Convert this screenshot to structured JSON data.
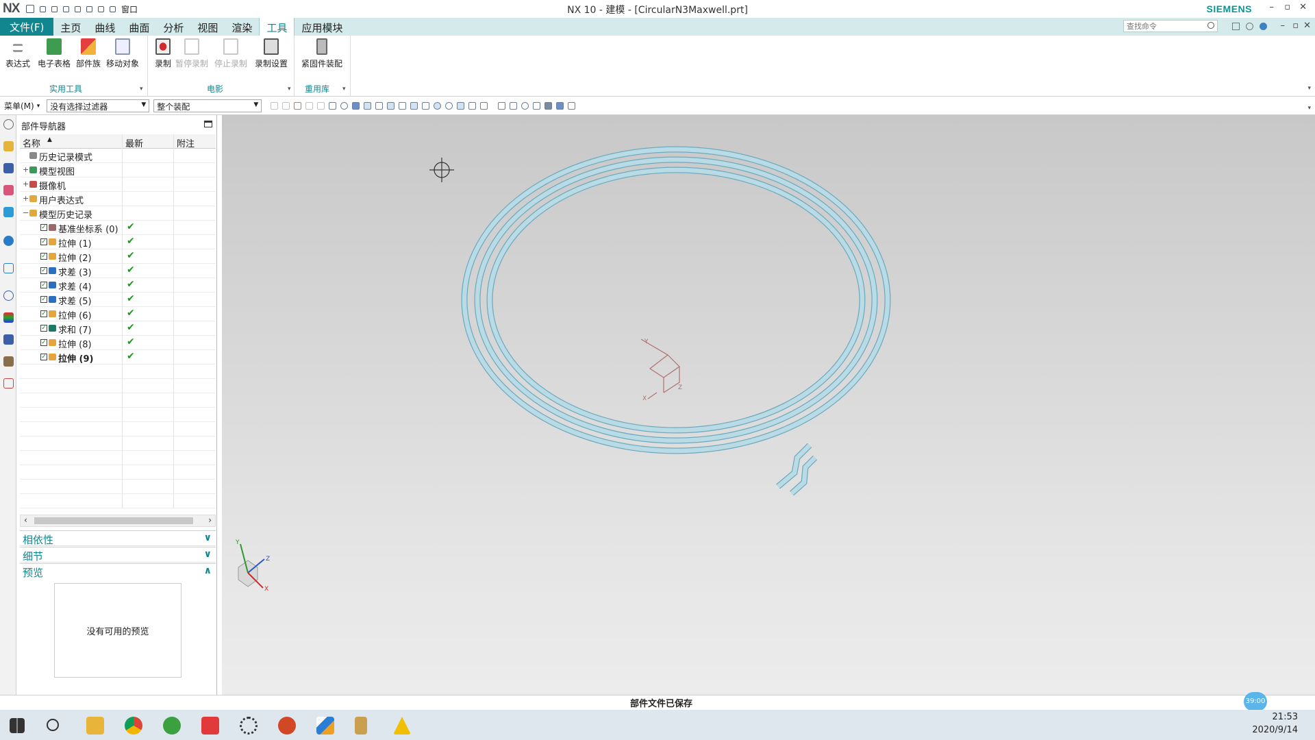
{
  "window": {
    "app_logo": "NX",
    "title": "NX 10 - 建模 - [CircularN3Maxwell.prt]",
    "brand": "SIEMENS",
    "quick_access_window": "窗口"
  },
  "menu": {
    "file": "文件(F)",
    "tabs": [
      "主页",
      "曲线",
      "曲面",
      "分析",
      "视图",
      "渲染",
      "工具",
      "应用模块"
    ],
    "active_tab": "工具",
    "search_placeholder": "查找命令"
  },
  "ribbon": {
    "groups": [
      {
        "label": "实用工具",
        "buttons": [
          "表达式",
          "电子表格",
          "部件族",
          "移动对象"
        ]
      },
      {
        "label": "电影",
        "buttons": [
          "录制",
          "暂停录制",
          "停止录制",
          "录制设置"
        ]
      },
      {
        "label": "重用库",
        "buttons": [
          "紧固件装配"
        ]
      }
    ]
  },
  "selection_bar": {
    "menu_button": "菜单(M)",
    "filter": "没有选择过滤器",
    "scope": "整个装配"
  },
  "navigator": {
    "title": "部件导航器",
    "columns": [
      "名称",
      "最新",
      "附注"
    ],
    "top_items": [
      {
        "label": "历史记录模式",
        "icon": "history-mode-icon",
        "expander": ""
      },
      {
        "label": "模型视图",
        "icon": "model-views-icon",
        "expander": "+"
      },
      {
        "label": "摄像机",
        "icon": "camera-icon",
        "expander": "+"
      },
      {
        "label": "用户表达式",
        "icon": "folder-icon",
        "expander": "+"
      },
      {
        "label": "模型历史记录",
        "icon": "folder-open-icon",
        "expander": "−"
      }
    ],
    "history": [
      {
        "label": "基准坐标系 (0)",
        "icon": "datum-csys-icon",
        "up_to_date": true
      },
      {
        "label": "拉伸 (1)",
        "icon": "extrude-icon",
        "up_to_date": true
      },
      {
        "label": "拉伸 (2)",
        "icon": "extrude-icon",
        "up_to_date": true
      },
      {
        "label": "求差 (3)",
        "icon": "subtract-icon",
        "up_to_date": true
      },
      {
        "label": "求差 (4)",
        "icon": "subtract-icon",
        "up_to_date": true
      },
      {
        "label": "求差 (5)",
        "icon": "subtract-icon",
        "up_to_date": true
      },
      {
        "label": "拉伸 (6)",
        "icon": "extrude-icon",
        "up_to_date": true
      },
      {
        "label": "求和 (7)",
        "icon": "unite-icon",
        "up_to_date": true
      },
      {
        "label": "拉伸 (8)",
        "icon": "extrude-icon",
        "up_to_date": true
      },
      {
        "label": "拉伸 (9)",
        "icon": "extrude-icon",
        "up_to_date": true,
        "bold": true
      }
    ],
    "panels": [
      {
        "label": "相依性",
        "state": "collapsed"
      },
      {
        "label": "细节",
        "state": "collapsed"
      },
      {
        "label": "预览",
        "state": "expanded"
      }
    ],
    "preview_text": "没有可用的预览"
  },
  "status": {
    "message": "部件文件已保存",
    "badge": "39:00"
  },
  "viewport": {
    "coil_color": "#b9dbe6",
    "coil_edge_color": "#6fa9bd",
    "triad_labels": {
      "x": "X",
      "y": "Y",
      "z": "Z"
    }
  },
  "taskbar": {
    "time": "21:53",
    "date": "2020/9/14",
    "apps": [
      "windows-start-icon",
      "search-icon",
      "file-explorer-icon",
      "chrome-icon",
      "tree-app-icon",
      "xmind-icon",
      "settings-icon",
      "powerpoint-icon",
      "nx-icon",
      "tool-icon",
      "autodesk-icon"
    ]
  }
}
